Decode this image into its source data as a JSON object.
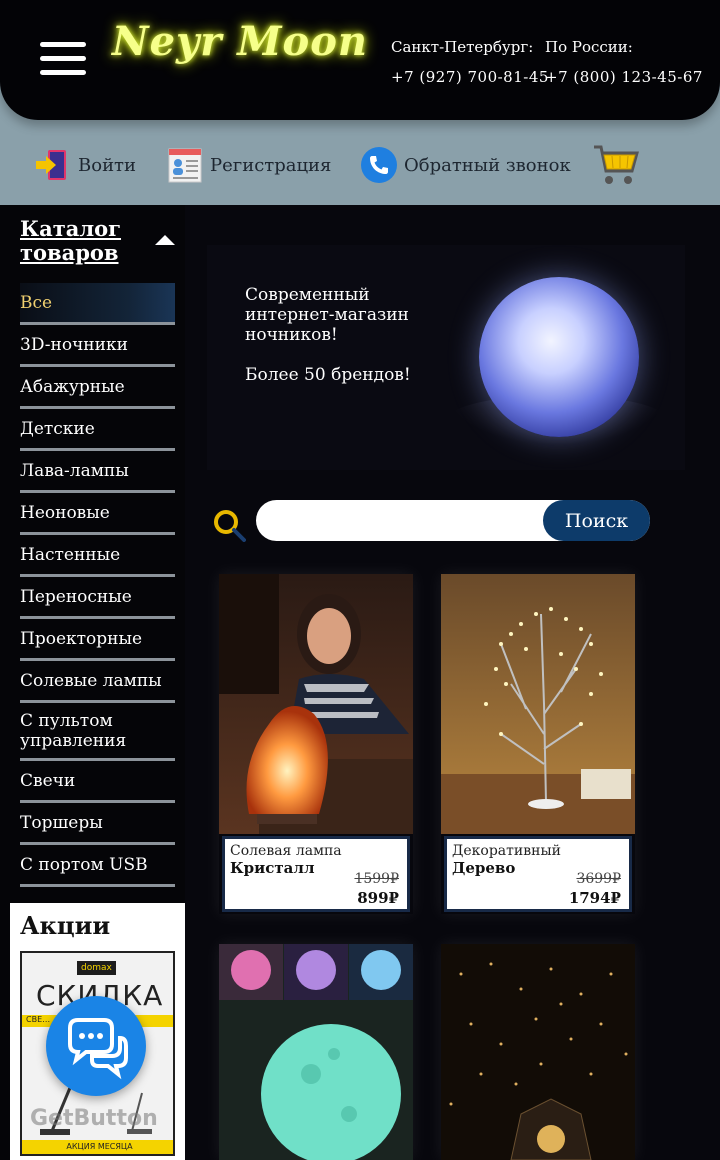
{
  "header": {
    "logo": "Neyr Moon",
    "spb_city": "Санкт-Петербург:",
    "spb_phone": "+7 (927) 700-81-45",
    "russia_label": "По России:",
    "russia_phone": "+7 (800) 123-45-67",
    "links": {
      "login": "Войти",
      "register": "Регистрация",
      "callback": "Обратный звонок"
    }
  },
  "sidebar": {
    "catalog_title": "Каталог товаров",
    "categories": [
      "Все",
      "3D-ночники",
      "Абажурные",
      "Детские",
      "Лава-лампы",
      "Неоновые",
      "Настенные",
      "Переносные",
      "Проекторные",
      "Солевые лампы",
      "С пультом управления",
      "Свечи",
      "Торшеры",
      "С портом USB"
    ],
    "promo_title": "Акции",
    "promo_brand": "domax",
    "promo_sale": "СКИДКА",
    "promo_strip": "СВЕ…                    …НЫЕ",
    "promo_footer": "АКЦИЯ МЕСЯЦА"
  },
  "banner": {
    "headline": "Современный интернет-магазин ночников!",
    "subline": "Более 50 брендов!"
  },
  "search": {
    "placeholder": "",
    "button": "Поиск"
  },
  "products": [
    {
      "category": "Солевая лампа",
      "name": "Кристалл",
      "old_price": "1599₽",
      "price": "899₽"
    },
    {
      "category": "Декоративный",
      "name": "Дерево",
      "old_price": "3699₽",
      "price": "1794₽"
    }
  ],
  "chat_widget": {
    "watermark": "GetButton"
  },
  "colors": {
    "accent_blue": "#0d3b6a",
    "logo_neon": "#f6ff8a",
    "header_band": "#8aa0aa",
    "chat_blue": "#1a84e6"
  }
}
